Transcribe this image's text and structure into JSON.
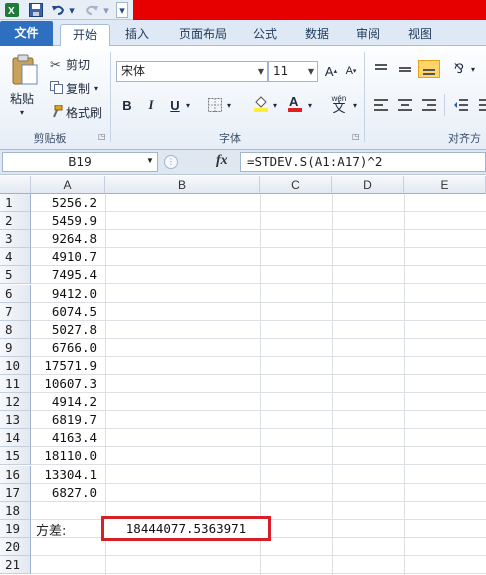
{
  "quick_access": {
    "save_icon": "save-icon",
    "undo_icon": "undo-icon",
    "redo_icon": "redo-icon"
  },
  "tabs": [
    {
      "label": "文件"
    },
    {
      "label": "开始"
    },
    {
      "label": "插入"
    },
    {
      "label": "页面布局"
    },
    {
      "label": "公式"
    },
    {
      "label": "数据"
    },
    {
      "label": "审阅"
    },
    {
      "label": "视图"
    }
  ],
  "ribbon": {
    "clipboard": {
      "paste": "粘贴",
      "cut": "剪切",
      "copy": "复制",
      "format_painter": "格式刷",
      "group_label": "剪贴板"
    },
    "font": {
      "font_name": "宋体",
      "font_size": "11",
      "bold": "B",
      "italic": "I",
      "underline": "U",
      "phonetic": "wén",
      "group_label": "字体",
      "font_color_accent": "#e02020",
      "fill_color_accent": "#ffee33"
    },
    "alignment": {
      "group_label": "对齐方"
    }
  },
  "formula_bar": {
    "name_box": "B19",
    "fx": "fx",
    "formula": "=STDEV.S(A1:A17)^2"
  },
  "columns": [
    "A",
    "B",
    "C",
    "D",
    "E"
  ],
  "rows": [
    {
      "n": "1",
      "a": "5256.2"
    },
    {
      "n": "2",
      "a": "5459.9"
    },
    {
      "n": "3",
      "a": "9264.8"
    },
    {
      "n": "4",
      "a": "4910.7"
    },
    {
      "n": "5",
      "a": "7495.4"
    },
    {
      "n": "6",
      "a": "9412.0"
    },
    {
      "n": "7",
      "a": "6074.5"
    },
    {
      "n": "8",
      "a": "5027.8"
    },
    {
      "n": "9",
      "a": "6766.0"
    },
    {
      "n": "10",
      "a": "17571.9"
    },
    {
      "n": "11",
      "a": "10607.3"
    },
    {
      "n": "12",
      "a": "4914.2"
    },
    {
      "n": "13",
      "a": "6819.7"
    },
    {
      "n": "14",
      "a": "4163.4"
    },
    {
      "n": "15",
      "a": "18110.0"
    },
    {
      "n": "16",
      "a": "13304.1"
    },
    {
      "n": "17",
      "a": "6827.0"
    },
    {
      "n": "18",
      "a": ""
    },
    {
      "n": "19",
      "a": ""
    },
    {
      "n": "20",
      "a": ""
    },
    {
      "n": "21",
      "a": ""
    }
  ],
  "row19": {
    "label": "方差:",
    "result": "18444077.5363971"
  },
  "colors": {
    "title_bar_red": "#e60000",
    "file_tab_blue": "#2f6fc0",
    "highlight_red": "#d61f26"
  }
}
